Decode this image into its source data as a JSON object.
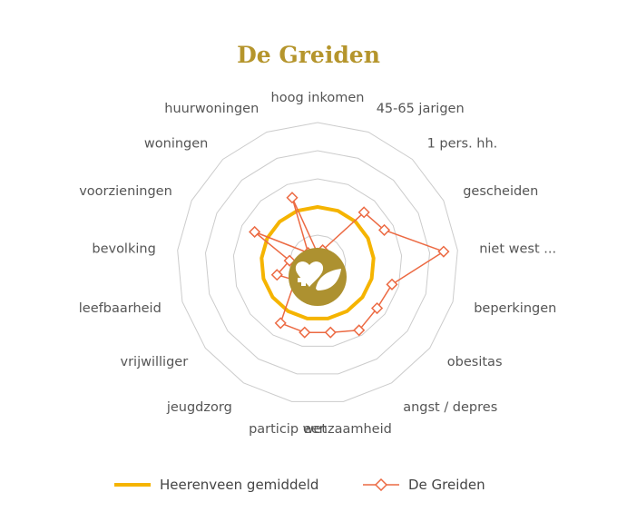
{
  "page": {
    "title": "De Greiden"
  },
  "colors": {
    "title": "#b5952c",
    "average": "#f5b400",
    "greiden": "#ec6a43",
    "grid": "#cccccc",
    "badge": "#ad9130",
    "badge_icon": "#ffffff"
  },
  "center_icon": "heart-leaf-icon",
  "chart_data": {
    "type": "radar",
    "title": "De Greiden",
    "axes": [
      "hoog inkomen",
      "45-65 jarigen",
      "1 pers. hh.",
      "gescheiden",
      "niet west ...",
      "beperkingen",
      "obesitas",
      "angst / depres",
      "eenzaamheid",
      "particip wet",
      "jeugdzorg",
      "vrijwilliger",
      "leefbaarheid",
      "bevolking",
      "voorzieningen",
      "woningen",
      "huurwoningen"
    ],
    "grid_levels": 5,
    "series": [
      {
        "name": "Heerenveen gemiddeld",
        "marker": "none",
        "values": [
          0.4,
          0.4,
          0.4,
          0.4,
          0.4,
          0.4,
          0.4,
          0.4,
          0.4,
          0.4,
          0.4,
          0.4,
          0.4,
          0.4,
          0.4,
          0.4,
          0.4
        ]
      },
      {
        "name": "De Greiden",
        "marker": "diamond-open",
        "values": [
          0.07,
          0.1,
          0.49,
          0.53,
          0.9,
          0.55,
          0.53,
          0.56,
          0.5,
          0.5,
          0.5,
          0.2,
          0.3,
          0.2,
          0.5,
          0.1,
          0.5
        ]
      }
    ],
    "legend": {
      "position": "bottom",
      "entries": [
        "Heerenveen gemiddeld",
        "De Greiden"
      ]
    }
  }
}
